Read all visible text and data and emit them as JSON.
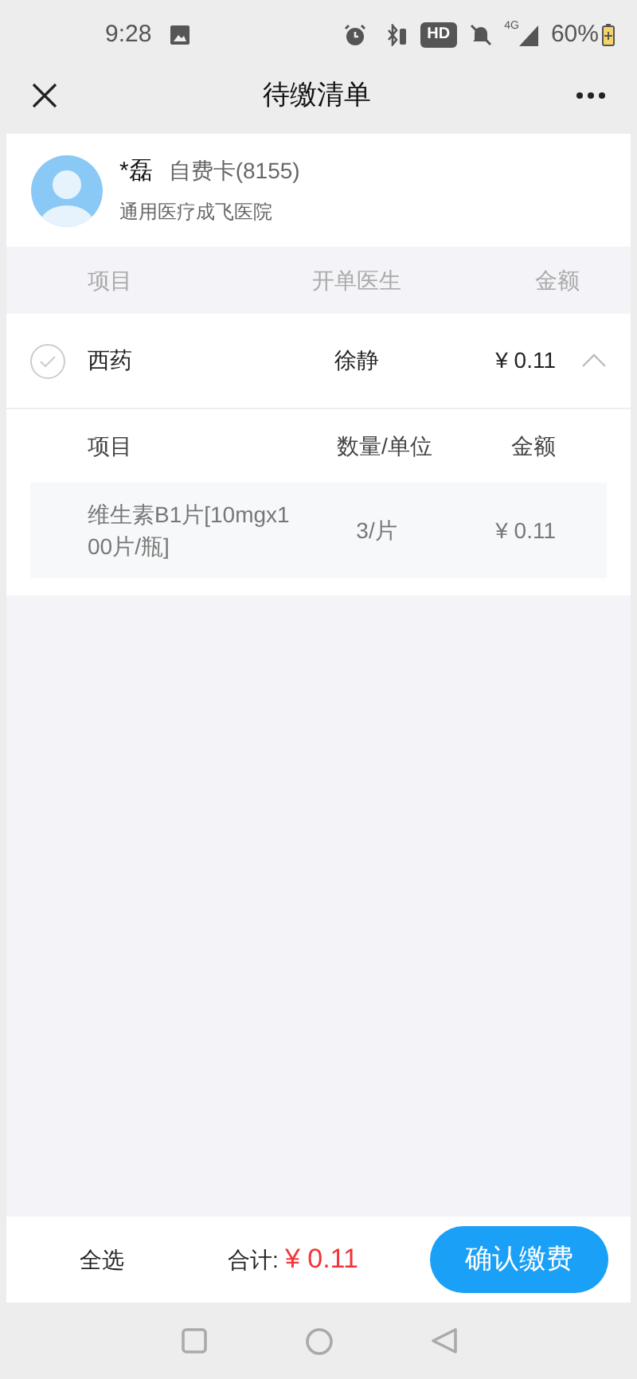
{
  "status_bar": {
    "time": "9:28",
    "hd": "HD",
    "network": "4G",
    "battery": "60%"
  },
  "nav": {
    "title": "待缴清单"
  },
  "patient": {
    "name": "*磊",
    "card": "自费卡(8155)",
    "hospital": "通用医疗成飞医院"
  },
  "table": {
    "columns": [
      "项目",
      "开单医生",
      "金额"
    ]
  },
  "groups": [
    {
      "name": "西药",
      "doctor": "徐静",
      "amount": "¥ 0.11",
      "checked": false,
      "expanded": true,
      "detail_columns": [
        "项目",
        "数量/单位",
        "金额"
      ],
      "items": [
        {
          "name": "维生素B1片[10mgx100片/瓶]",
          "quantity": "3/片",
          "amount": "¥ 0.11"
        }
      ]
    }
  ],
  "footer": {
    "select_all": "全选",
    "total_label": "合计:",
    "total": "¥ 0.11",
    "pay_button": "确认缴费"
  }
}
